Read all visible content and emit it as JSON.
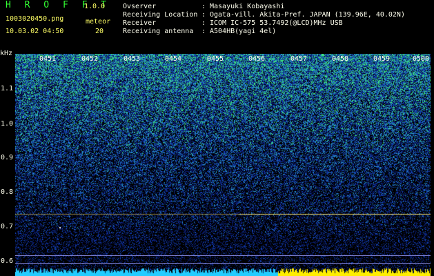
{
  "header": {
    "app_title": "H R O F F T",
    "version": "1.0.0",
    "filename": "1003020450.png",
    "meteor_label": "meteor",
    "meteor_count": "20",
    "datetime": "10.03.02 04:50"
  },
  "info": [
    {
      "label": "Ovserver",
      "sep": ":",
      "value": "Masayuki Kobayashi"
    },
    {
      "label": "Receiving Location",
      "sep": ":",
      "value": "Ogata-vill. Akita-Pref. JAPAN (139.96E, 40.02N)"
    },
    {
      "label": "Receiver",
      "sep": ":",
      "value": "ICOM IC-575 53.7492(@LCD)MHz USB"
    },
    {
      "label": "Receiving antenna",
      "sep": ":",
      "value": "A504HB(yagi 4el)"
    }
  ],
  "axis": {
    "y_unit": "kHz",
    "y_ticks": [
      "1.1",
      "1.0",
      "0.9",
      "0.8",
      "0.7",
      "0.6"
    ],
    "x_ticks": [
      "0451",
      "0452",
      "0453",
      "0454",
      "0455",
      "0456",
      "0457",
      "0458",
      "0459",
      "0500"
    ]
  },
  "colors": {
    "background": "#000000",
    "header_text": "#ffffee",
    "title_green": "#33ff33",
    "accent_yellow": "#ffff66",
    "spectrum_low": "#0a1a6e",
    "spectrum_high": "#40ff80"
  }
}
